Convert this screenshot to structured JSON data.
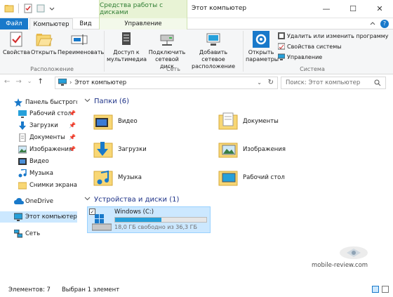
{
  "window": {
    "context_tab": "Средства работы с дисками",
    "title": "Этот компьютер",
    "controls": [
      "—",
      "☐",
      "✕"
    ]
  },
  "ribbon_tabs": {
    "file": "Файл",
    "computer": "Компьютер",
    "view": "Вид",
    "manage": "Управление"
  },
  "ribbon": {
    "properties": "Свойства",
    "open": "Открыть",
    "rename": "Переименовать",
    "group_location": "Расположение",
    "media_access": "Доступ к мультимедиа",
    "map_drive": "Подключить сетевой диск",
    "add_network_location": "Добавить сетевое расположение",
    "group_network": "Сеть",
    "open_settings": "Открыть параметры",
    "uninstall": "Удалить или изменить программу",
    "system_properties": "Свойства системы",
    "manage": "Управление",
    "group_system": "Система"
  },
  "address": {
    "path": "Этот компьютер",
    "search_placeholder": "Поиск: Этот компьютер"
  },
  "nav": {
    "quick_access": "Панель быстрого до",
    "desktop": "Рабочий стол",
    "downloads": "Загрузки",
    "documents": "Документы",
    "images": "Изображения",
    "video": "Видео",
    "music": "Музыка",
    "screenshots": "Снимки экрана",
    "onedrive": "OneDrive",
    "this_pc": "Этот компьютер",
    "network": "Сеть"
  },
  "folders": {
    "header": "Папки (6)",
    "items": [
      "Видео",
      "Документы",
      "Загрузки",
      "Изображения",
      "Музыка",
      "Рабочий стол"
    ]
  },
  "devices": {
    "header": "Устройства и диски (1)",
    "drive_name": "Windows (C:)",
    "drive_free": "18,0 ГБ свободно из 36,3 ГБ",
    "used_fraction": 0.504
  },
  "watermark": "mobile-review.com",
  "status": {
    "count": "Элементов: 7",
    "selected": "Выбран 1 элемент"
  },
  "colors": {
    "accent": "#1979ca",
    "selection": "#cce8ff",
    "folder": "#f8d775",
    "header_text": "#1e3287",
    "context_green": "#2e7d32"
  }
}
